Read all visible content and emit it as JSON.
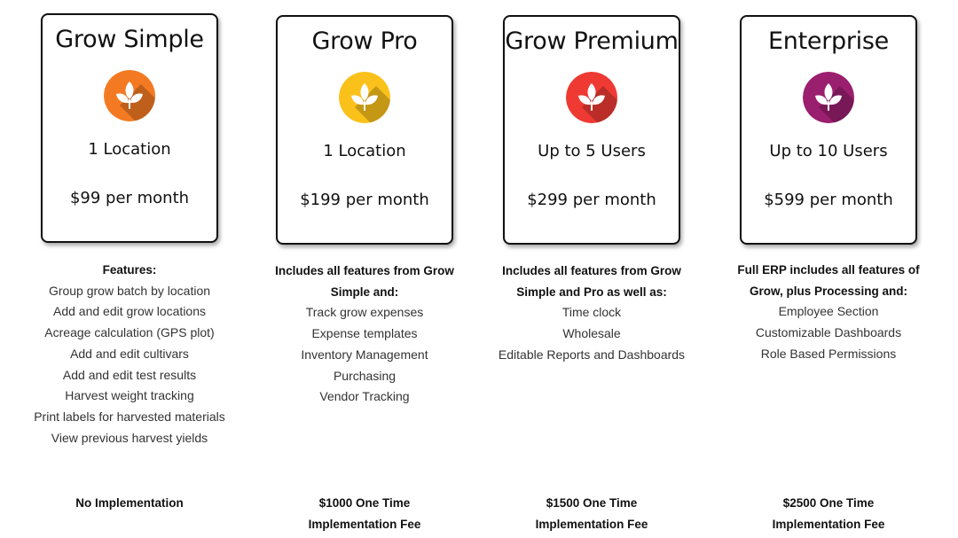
{
  "plans": [
    {
      "title": "Grow Simple",
      "icon": "leaf-icon",
      "color": "#F37A22",
      "subtitle": "1 Location",
      "price": "$99 per month",
      "features_heading": "Features:",
      "features": [
        "Group grow batch by location",
        "Add and edit grow locations",
        "Acreage calculation (GPS plot)",
        "Add and edit cultivars",
        "Add and edit test results",
        "Harvest weight tracking",
        "Print labels for harvested materials",
        "View previous harvest yields"
      ],
      "fee_line1": "No Implementation",
      "fee_line2": ""
    },
    {
      "title": "Grow Pro",
      "icon": "leaf-icon",
      "color": "#FBC11B",
      "subtitle": "1 Location",
      "price": "$199 per month",
      "features_heading": "Includes all features from Grow Simple and:",
      "features": [
        "Track grow expenses",
        "Expense templates",
        "Inventory Management",
        "Purchasing",
        "Vendor Tracking"
      ],
      "fee_line1": "$1000 One Time",
      "fee_line2": "Implementation Fee"
    },
    {
      "title": "Grow Premium",
      "icon": "leaf-icon",
      "color": "#EE3A33",
      "subtitle": "Up to 5 Users",
      "price": "$299 per month",
      "features_heading": "Includes all features from Grow Simple and Pro as well as:",
      "features": [
        "Time clock",
        "Wholesale",
        "Editable Reports and Dashboards"
      ],
      "fee_line1": "$1500 One Time",
      "fee_line2": "Implementation Fee"
    },
    {
      "title": "Enterprise",
      "icon": "leaf-icon",
      "color": "#9B1F6F",
      "subtitle": "Up to 10 Users",
      "price": "$599 per month",
      "features_heading": "Full ERP includes all features of Grow, plus Processing and:",
      "features": [
        "Employee Section",
        "Customizable Dashboards",
        "Role Based Permissions"
      ],
      "fee_line1": "$2500 One Time",
      "fee_line2": "Implementation Fee"
    }
  ]
}
